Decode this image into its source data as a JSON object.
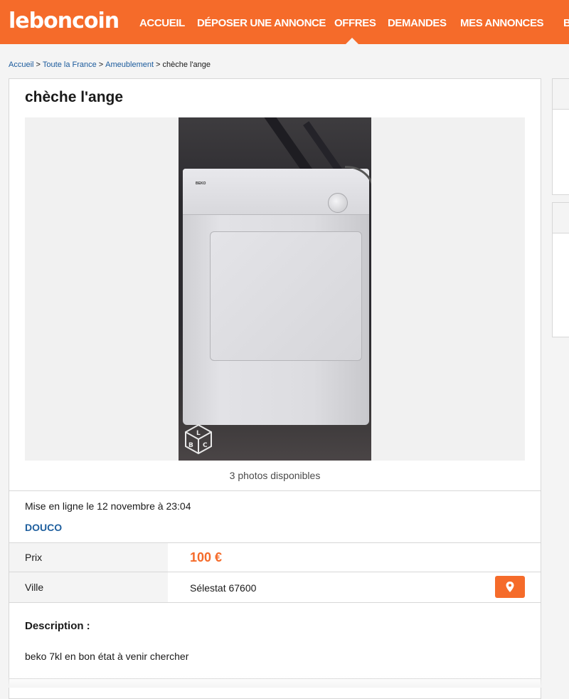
{
  "brand": {
    "logo_text": "leboncoin",
    "accent_color": "#f56b2a"
  },
  "nav": {
    "items": [
      {
        "label": "ACCUEIL"
      },
      {
        "label": "DÉPOSER UNE ANNONCE"
      },
      {
        "label": "OFFRES"
      },
      {
        "label": "DEMANDES"
      },
      {
        "label": "MES ANNONCES"
      },
      {
        "label": "B"
      }
    ],
    "active": "OFFRES"
  },
  "breadcrumb": {
    "items": [
      "Accueil",
      "Toute la France",
      "Ameublement"
    ],
    "current": "chèche l'ange",
    "separator": ">"
  },
  "listing": {
    "title": "chèche l'ange",
    "photos_caption": "3 photos disponibles",
    "photo_watermark_letters": [
      "L",
      "B",
      "C"
    ],
    "photo_brand_text": "BEKO",
    "posted": "Mise en ligne le 12 novembre à 23:04",
    "seller": "DOUCO",
    "price_label": "Prix",
    "price": "100 €",
    "city_label": "Ville",
    "city": "Sélestat 67600",
    "map_icon": "map-pin-icon",
    "description_title": "Description :",
    "description": "beko 7kl en bon état à venir chercher"
  }
}
